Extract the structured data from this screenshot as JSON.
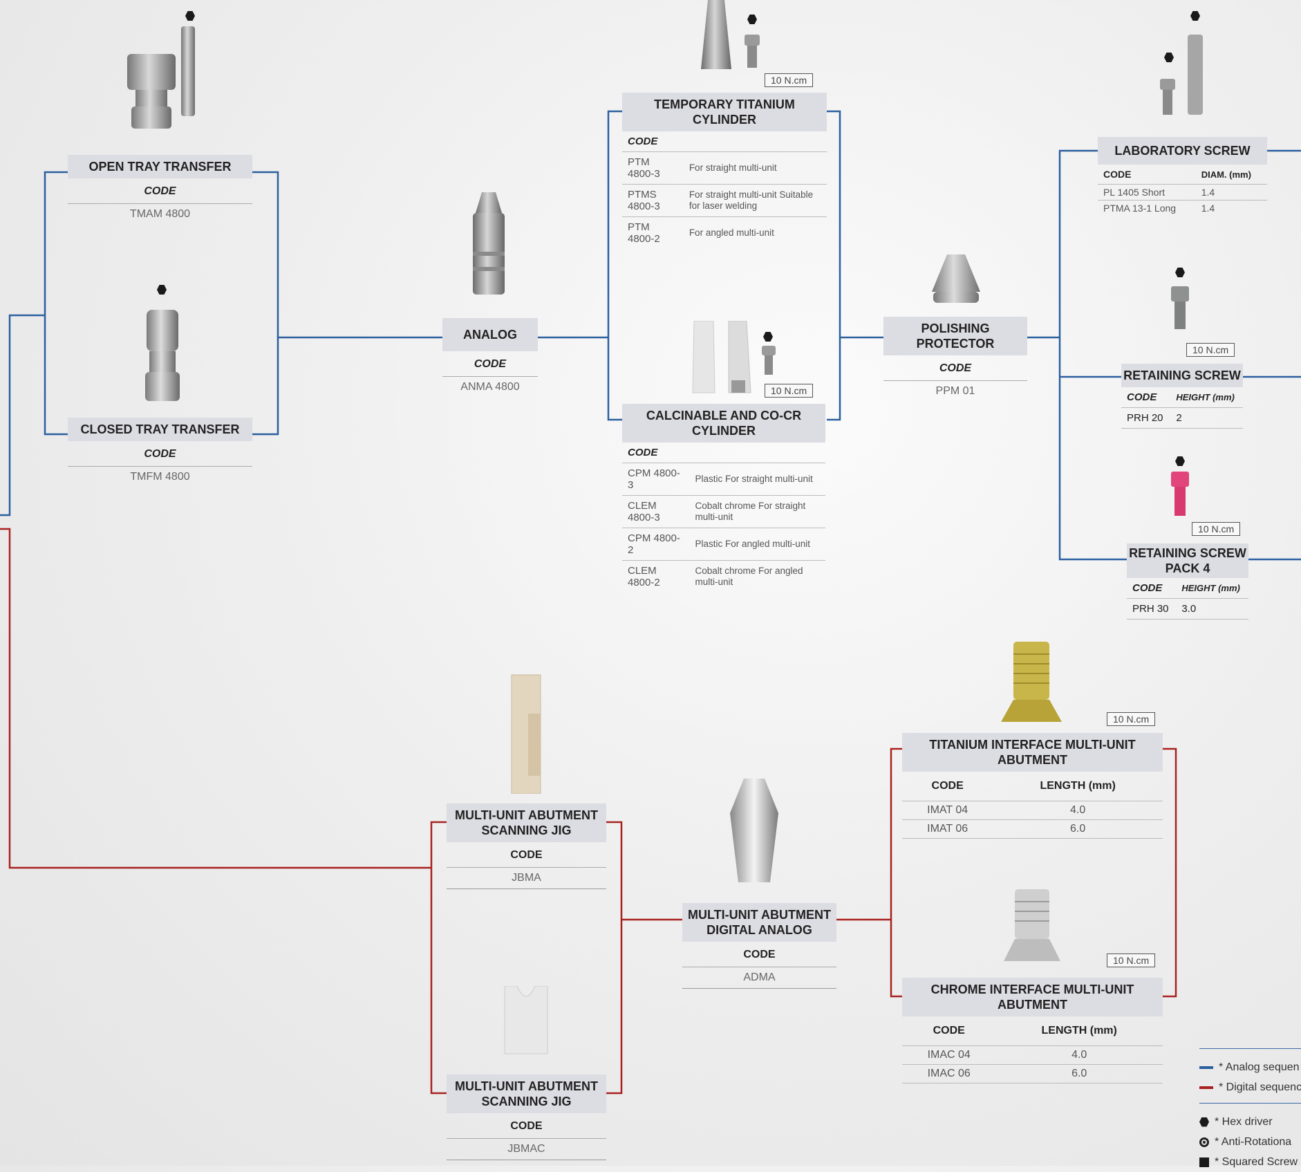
{
  "colors": {
    "analog": "#2a5f9e",
    "digital": "#a8211f",
    "title_bg": "#dcdce3"
  },
  "open_tray": {
    "title": "OPEN TRAY TRANSFER",
    "code_label": "CODE",
    "code": "TMAM 4800"
  },
  "closed_tray": {
    "title": "CLOSED TRAY TRANSFER",
    "code_label": "CODE",
    "code": "TMFM 4800"
  },
  "analog": {
    "title": "ANALOG",
    "code_label": "CODE",
    "code": "ANMA 4800"
  },
  "temp_cyl": {
    "torque": "10 N.cm",
    "title": "TEMPORARY TITANIUM CYLINDER",
    "code_label": "CODE",
    "rows": [
      {
        "code": "PTM 4800-3",
        "desc": "For straight multi-unit"
      },
      {
        "code": "PTMS 4800-3",
        "desc": "For straight multi-unit Suitable for laser welding"
      },
      {
        "code": "PTM 4800-2",
        "desc": "For angled multi-unit"
      }
    ]
  },
  "calc_cyl": {
    "torque": "10 N.cm",
    "title": "CALCINABLE AND CO-CR CYLINDER",
    "code_label": "CODE",
    "rows": [
      {
        "code": "CPM 4800-3",
        "desc": "Plastic For straight multi-unit"
      },
      {
        "code": "CLEM 4800-3",
        "desc": "Cobalt chrome For straight multi-unit"
      },
      {
        "code": "CPM 4800-2",
        "desc": "Plastic For angled multi-unit"
      },
      {
        "code": "CLEM 4800-2",
        "desc": "Cobalt chrome For angled multi-unit"
      }
    ]
  },
  "polishing": {
    "title": "POLISHING PROTECTOR",
    "code_label": "CODE",
    "code": "PPM 01"
  },
  "lab_screw": {
    "title": "LABORATORY SCREW",
    "code_label": "CODE",
    "diam_label": "DIAM. (mm)",
    "rows": [
      {
        "code": "PL 1405 Short",
        "diam": "1.4"
      },
      {
        "code": "PTMA 13-1 Long",
        "diam": "1.4"
      }
    ]
  },
  "retaining": {
    "torque": "10 N.cm",
    "title": "RETAINING SCREW",
    "code_label": "CODE",
    "height_label": "HEIGHT (mm)",
    "rows": [
      {
        "code": "PRH 20",
        "height": "2"
      }
    ]
  },
  "retaining4": {
    "torque": "10 N.cm",
    "title": "RETAINING SCREW PACK 4",
    "code_label": "CODE",
    "height_label": "HEIGHT (mm)",
    "rows": [
      {
        "code": "PRH 30",
        "height": "3.0"
      }
    ]
  },
  "jig1": {
    "title": "MULTI-UNIT ABUTMENT SCANNING JIG",
    "code_label": "CODE",
    "code": "JBMA"
  },
  "jig2": {
    "title": "MULTI-UNIT ABUTMENT SCANNING JIG",
    "code_label": "CODE",
    "code": "JBMAC"
  },
  "dig_analog": {
    "title": "MULTI-UNIT ABUTMENT DIGITAL ANALOG",
    "code_label": "CODE",
    "code": "ADMA"
  },
  "ti_interface": {
    "torque": "10 N.cm",
    "title": "TITANIUM INTERFACE MULTI-UNIT ABUTMENT",
    "code_label": "CODE",
    "length_label": "LENGTH (mm)",
    "rows": [
      {
        "code": "IMAT 04",
        "length": "4.0"
      },
      {
        "code": "IMAT 06",
        "length": "6.0"
      }
    ]
  },
  "cr_interface": {
    "torque": "10 N.cm",
    "title": "CHROME INTERFACE MULTI-UNIT ABUTMENT",
    "code_label": "CODE",
    "length_label": "LENGTH (mm)",
    "rows": [
      {
        "code": "IMAC 04",
        "length": "4.0"
      },
      {
        "code": "IMAC 06",
        "length": "6.0"
      }
    ]
  },
  "legend": {
    "analog": "* Analog sequen",
    "digital": "* Digital sequenc",
    "hex": "* Hex driver",
    "anti": "* Anti-Rotationa",
    "squared": "* Squared Screw"
  }
}
